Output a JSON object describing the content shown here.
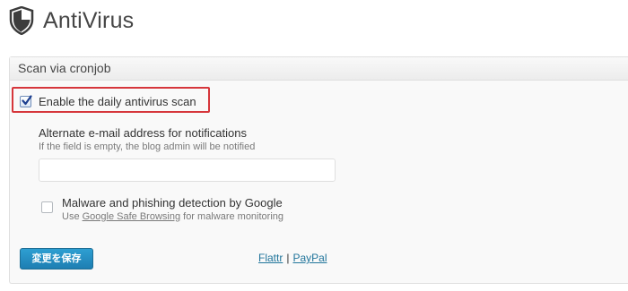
{
  "header": {
    "icon": "shield-icon",
    "title": "AntiVirus"
  },
  "box": {
    "title": "Scan via cronjob",
    "daily_scan": {
      "label": "Enable the daily antivirus scan",
      "checked": true,
      "highlight_color": "#d6363b"
    },
    "email": {
      "label": "Alternate e-mail address for notifications",
      "hint": "If the field is empty, the blog admin will be notified",
      "value": "",
      "placeholder": ""
    },
    "google": {
      "label": "Malware and phishing detection by Google",
      "checked": false,
      "hint_prefix": "Use ",
      "hint_link": "Google Safe Browsing",
      "hint_suffix": " for malware monitoring"
    },
    "save_label": "変更を保存",
    "links": {
      "flattr": "Flattr",
      "separator": "|",
      "paypal": "PayPal"
    }
  },
  "colors": {
    "button": "#2e9fd2",
    "link": "#21759b"
  }
}
